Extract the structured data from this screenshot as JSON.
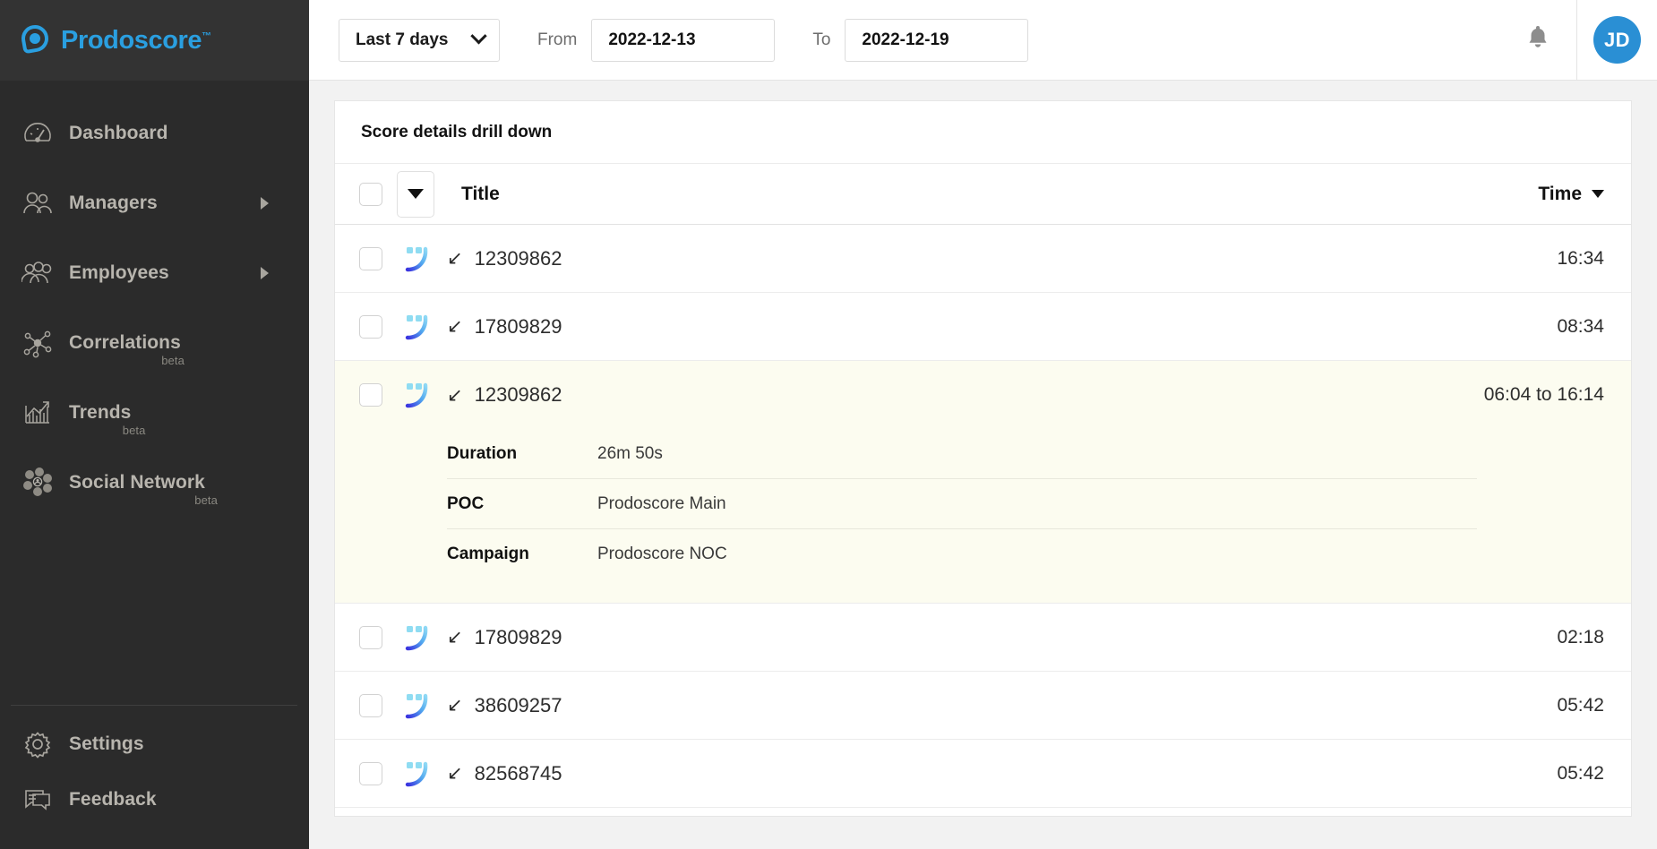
{
  "brand": {
    "name": "Prodoscore",
    "tm": "™",
    "accent_color": "#2a9fe0"
  },
  "sidebar": {
    "items": [
      {
        "label": "Dashboard",
        "icon": "gauge-icon",
        "beta": "",
        "has_arrow": false
      },
      {
        "label": "Managers",
        "icon": "managers-icon",
        "beta": "",
        "has_arrow": true
      },
      {
        "label": "Employees",
        "icon": "employees-icon",
        "beta": "",
        "has_arrow": true
      },
      {
        "label": "Correlations",
        "icon": "network-nodes-icon",
        "beta": "beta",
        "has_arrow": false
      },
      {
        "label": "Trends",
        "icon": "bar-chart-arrow-icon",
        "beta": "beta",
        "has_arrow": false
      },
      {
        "label": "Social Network",
        "icon": "social-network-icon",
        "beta": "beta",
        "has_arrow": false
      }
    ],
    "bottom_items": [
      {
        "label": "Settings",
        "icon": "gear-icon"
      },
      {
        "label": "Feedback",
        "icon": "chat-bubbles-icon"
      }
    ]
  },
  "topbar": {
    "range_label": "Last 7 days",
    "from_label": "From",
    "from_value": "2022-12-13",
    "to_label": "To",
    "to_value": "2022-12-19",
    "bell_icon": "bell-icon",
    "avatar_initials": "JD",
    "avatar_color": "#2a8fd4"
  },
  "card": {
    "title": "Score details drill down",
    "columns": {
      "title": "Title",
      "time": "Time"
    },
    "rows": [
      {
        "title": "12309862",
        "time": "16:34",
        "direction_icon": "incoming-call-arrow",
        "expanded": false
      },
      {
        "title": "17809829",
        "time": "08:34",
        "direction_icon": "incoming-call-arrow",
        "expanded": false
      },
      {
        "title": "12309862",
        "time": "06:04 to 16:14",
        "direction_icon": "incoming-call-arrow",
        "expanded": true,
        "details": [
          {
            "key": "Duration",
            "value": "26m 50s"
          },
          {
            "key": "POC",
            "value": "Prodoscore Main"
          },
          {
            "key": "Campaign",
            "value": "Prodoscore NOC"
          }
        ]
      },
      {
        "title": "17809829",
        "time": "02:18",
        "direction_icon": "incoming-call-arrow",
        "expanded": false
      },
      {
        "title": "38609257",
        "time": "05:42",
        "direction_icon": "incoming-call-arrow",
        "expanded": false
      },
      {
        "title": "82568745",
        "time": "05:42",
        "direction_icon": "incoming-call-arrow",
        "expanded": false
      }
    ]
  }
}
